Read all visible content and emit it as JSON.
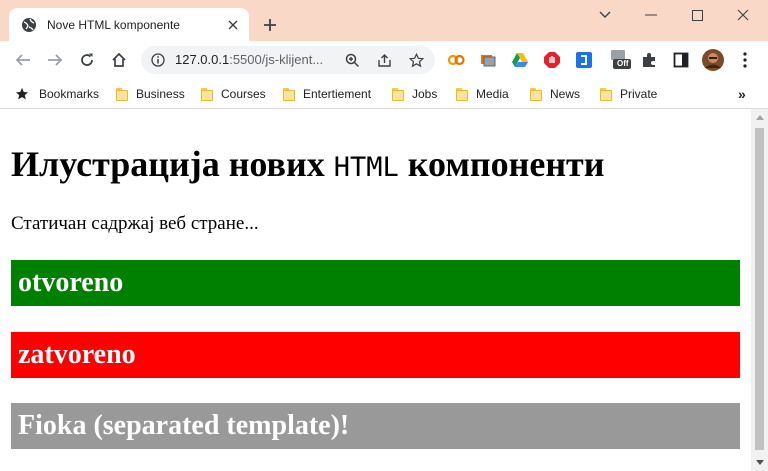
{
  "window": {
    "tab_title": "Nove HTML komponente",
    "titlebar_color": "#f9d8c7",
    "controls": [
      "chevron-down-icon",
      "minimize-icon",
      "maximize-icon",
      "close-icon"
    ]
  },
  "toolbar": {
    "url_host": "127.0.0.1",
    "url_rest": ":5500/js-klijent...",
    "extensions": [
      "cc-extension-icon",
      "screen-capture-icon",
      "google-drive-icon",
      "adblock-icon",
      "bracket-extension-icon",
      "off-extension-icon",
      "puzzle-icon",
      "side-panel-icon",
      "profile-avatar"
    ],
    "off_badge": "Off"
  },
  "bookmarks": {
    "star_label": "Bookmarks",
    "folders": [
      "Business",
      "Courses",
      "Entertiement",
      "Jobs",
      "Media",
      "News",
      "Private"
    ],
    "more": "»"
  },
  "page": {
    "title_part1": "Илустрација нових ",
    "title_html": "HTML",
    "title_part2": " компоненти",
    "static_text": "Статичан садржај веб стране...",
    "panels": [
      {
        "text": "otvoreno",
        "color": "#008000"
      },
      {
        "text": "zatvoreno",
        "color": "#ff0000"
      },
      {
        "text": "Fioka (separated template)!",
        "color": "#999999"
      }
    ]
  }
}
